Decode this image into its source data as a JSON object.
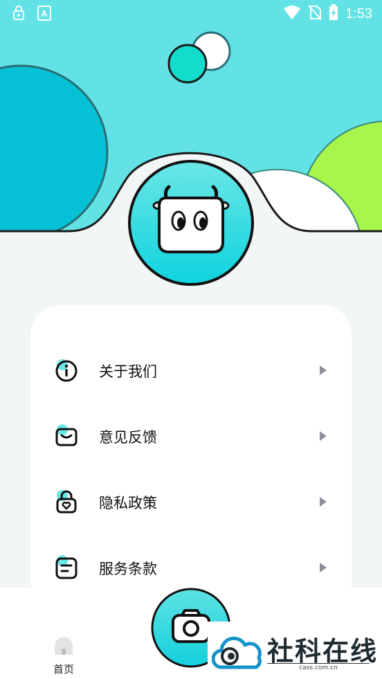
{
  "status_bar": {
    "time": "1:53",
    "left_icons": [
      "lock-notification-icon",
      "text-a-icon"
    ],
    "right_icons": [
      "wifi-icon",
      "no-sim-icon",
      "battery-charging-icon"
    ]
  },
  "menu": {
    "items": [
      {
        "label": "关于我们",
        "icon": "info-icon"
      },
      {
        "label": "意见反馈",
        "icon": "mail-icon"
      },
      {
        "label": "隐私政策",
        "icon": "lock-heart-icon"
      },
      {
        "label": "服务条款",
        "icon": "document-icon"
      }
    ]
  },
  "bottom_nav": {
    "home_label": "首页",
    "camera_icon": "camera-icon"
  },
  "watermark": {
    "title": "社科在线",
    "url": "cass.com.cn"
  },
  "colors": {
    "header_bg": "#62e2e4",
    "accent_cyan": "#19d2dc",
    "accent_green": "#a8f54b",
    "dark_outline": "#1a1a1a"
  }
}
